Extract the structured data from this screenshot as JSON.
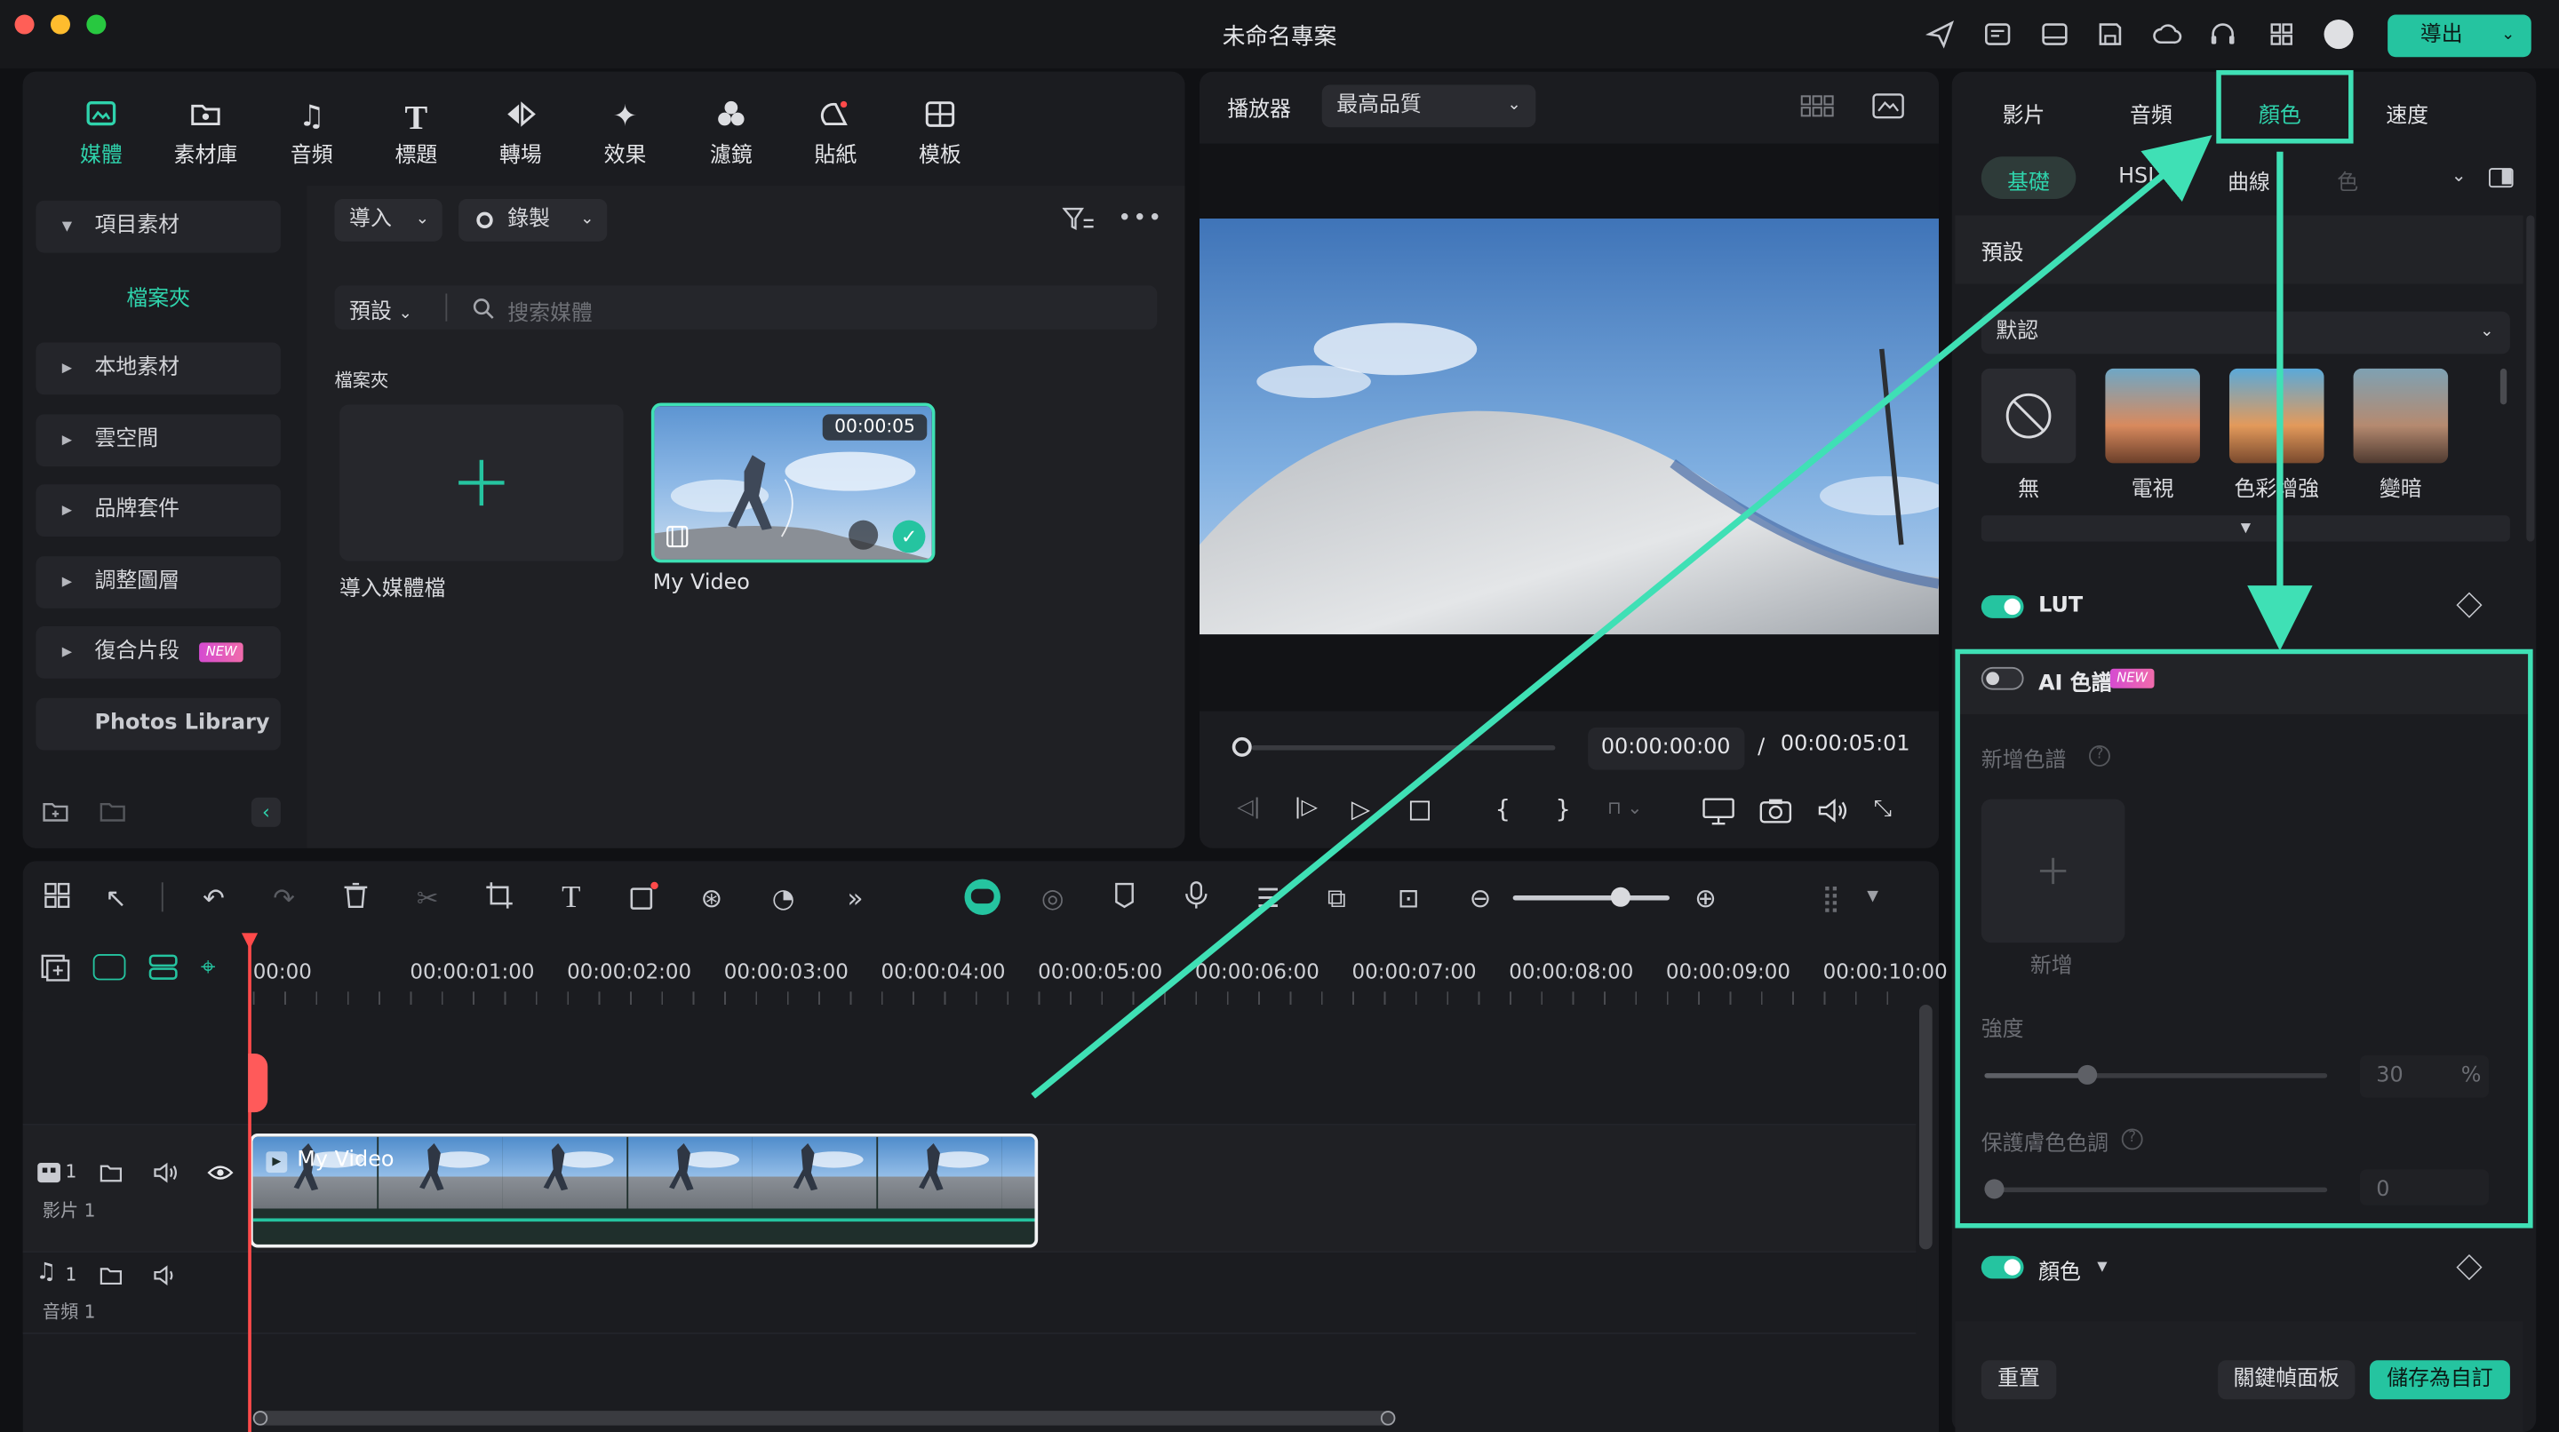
{
  "window": {
    "title": "未命名專案"
  },
  "titlebar_icons": [
    "send-icon",
    "project-icon",
    "layout-icon",
    "save-icon",
    "cloud-icon",
    "headset-icon",
    "grid-icon",
    "avatar"
  ],
  "export": {
    "label": "導出"
  },
  "media_tabs": [
    {
      "label": "媒體",
      "icon": "media-icon",
      "active": true
    },
    {
      "label": "素材庫",
      "icon": "library-icon"
    },
    {
      "label": "音頻",
      "icon": "music-icon"
    },
    {
      "label": "標題",
      "icon": "title-icon"
    },
    {
      "label": "轉場",
      "icon": "transition-icon"
    },
    {
      "label": "效果",
      "icon": "effect-icon"
    },
    {
      "label": "濾鏡",
      "icon": "filter-icon"
    },
    {
      "label": "貼紙",
      "icon": "sticker-icon"
    },
    {
      "label": "模板",
      "icon": "template-icon"
    }
  ],
  "sidebar": {
    "items": [
      {
        "label": "項目素材"
      },
      {
        "label": "檔案夾"
      },
      {
        "label": "本地素材"
      },
      {
        "label": "雲空間"
      },
      {
        "label": "品牌套件"
      },
      {
        "label": "調整圖層"
      },
      {
        "label": "復合片段",
        "badge": "NEW"
      },
      {
        "label": "Photos Library"
      }
    ]
  },
  "media_panel": {
    "import_label": "導入",
    "record_label": "錄製",
    "sort_label": "預設",
    "search_placeholder": "搜索媒體",
    "folder_heading": "檔案夾",
    "import_tile_label": "導入媒體檔",
    "clip": {
      "name": "My Video",
      "duration": "00:00:05"
    }
  },
  "player": {
    "label": "播放器",
    "quality": "最高品質",
    "current_time": "00:00:00:00",
    "separator": "/",
    "total_time": "00:00:05:01"
  },
  "right_panel": {
    "tabs": [
      "影片",
      "音頻",
      "顏色",
      "速度"
    ],
    "active_tab": "顏色",
    "subtabs": [
      "基礎",
      "HSL",
      "曲線",
      "色"
    ],
    "preset_section": "預設",
    "preset_dropdown": "默認",
    "presets": [
      "無",
      "電視",
      "色彩增強",
      "變暗"
    ],
    "lut_label": "LUT",
    "ai_palette_label": "AI 色譜",
    "ai_palette_badge": "NEW",
    "add_palette_label": "新增色譜",
    "add_label": "新增",
    "strength_label": "強度",
    "strength_value": "30",
    "strength_unit": "%",
    "strength_level": 0.3,
    "protect_skin_label": "保護膚色色調",
    "protect_skin_value": "0",
    "color_label": "顏色",
    "reset_label": "重置",
    "keyframe_panel_label": "關鍵幀面板",
    "save_custom_label": "儲存為自訂"
  },
  "timeline": {
    "ruler": [
      "00:00",
      "00:00:01:00",
      "00:00:02:00",
      "00:00:03:00",
      "00:00:04:00",
      "00:00:05:00",
      "00:00:06:00",
      "00:00:07:00",
      "00:00:08:00",
      "00:00:09:00",
      "00:00:10:00"
    ],
    "video_track_label": "影片 1",
    "video_track_number": "1",
    "audio_track_label": "音頻 1",
    "audio_track_number": "1",
    "clip_label": "My Video"
  },
  "colors": {
    "accent": "#25c4a0",
    "highlight": "#3fe0b5",
    "playhead": "#ff4a4a"
  }
}
